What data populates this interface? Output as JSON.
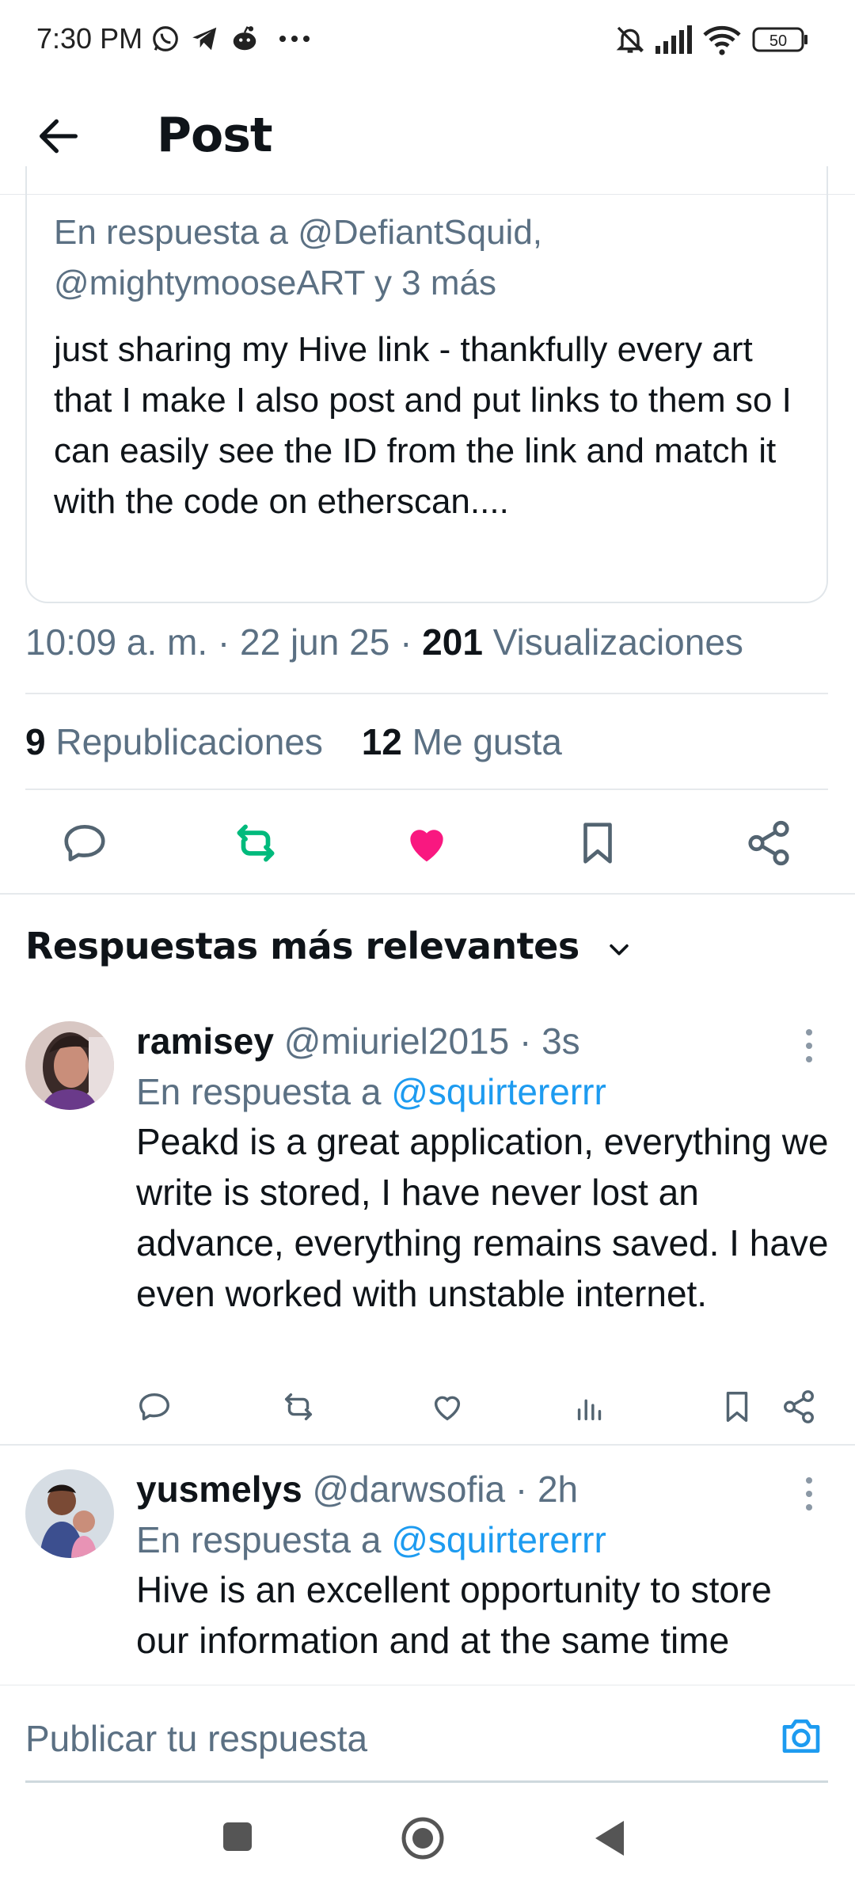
{
  "status_bar": {
    "time": "7:30 PM",
    "battery": "50",
    "icons": [
      "whatsapp-icon",
      "telegram-icon",
      "reddit-icon",
      "more-dots-icon",
      "mute-bell-icon",
      "signal-icon",
      "wifi-icon",
      "battery-icon"
    ]
  },
  "header": {
    "title": "Post",
    "back_icon": "arrow-left-icon"
  },
  "post": {
    "reply_to": "En respuesta a @DefiantSquid, @mightymooseART y 3 más",
    "text": "just sharing my Hive link - thankfully every art that I make I also post and put links to them so I can easily see the ID from the link and match it with the code on etherscan....",
    "time": "10:09 a. m. · 22 jun 25 · ",
    "views_count": "201",
    "views_label": " Visualizaciones",
    "reposts_count": "9",
    "reposts_label": " Republicaciones",
    "likes_count": "12",
    "likes_label": " Me gusta"
  },
  "actions": {
    "icons": [
      "reply-icon",
      "repost-icon",
      "like-icon",
      "bookmark-icon",
      "share-icon"
    ],
    "colors": {
      "repost": "#00ba7c",
      "like": "#f91880",
      "neutral": "#536471"
    }
  },
  "sort": {
    "label": "Respuestas más relevantes"
  },
  "replies": [
    {
      "name": "ramisey",
      "handle": "@miuriel2015",
      "time": " · 3s",
      "reply_prefix": "En respuesta a ",
      "mention": "@squirtererrr",
      "text": "Peakd is a great application, everything we write is stored, I have never lost an advance, everything remains saved. I have even worked with unstable internet."
    },
    {
      "name": "yusmelys",
      "handle": "@darwsofia",
      "time": " · 2h",
      "reply_prefix": "En respuesta a ",
      "mention": "@squirtererrr",
      "text": "Hive is an excellent opportunity to store our information and at the same time"
    }
  ],
  "composer": {
    "placeholder": "Publicar tu respuesta"
  }
}
